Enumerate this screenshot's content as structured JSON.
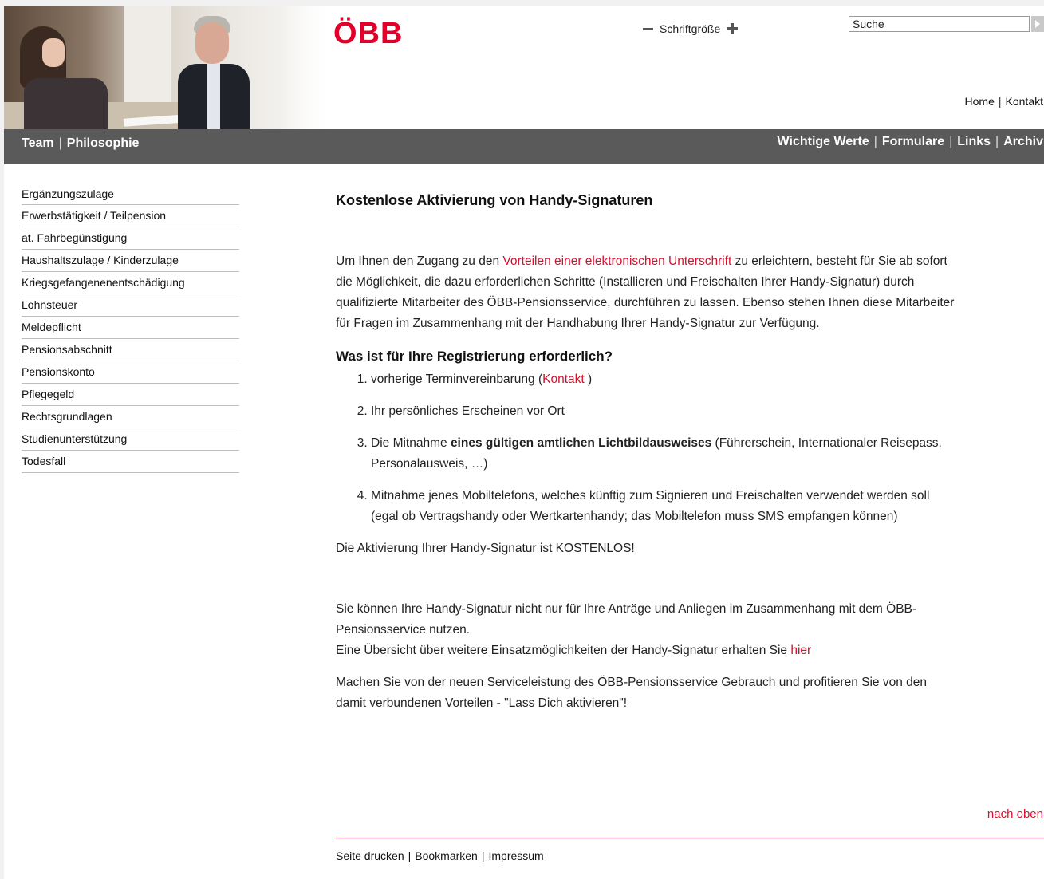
{
  "header": {
    "logo": "ÖBB",
    "font_size_label": "Schriftgröße",
    "search_placeholder": "Suche",
    "top_links": [
      "Home",
      "Kontakt"
    ]
  },
  "navbar": {
    "left": [
      "Team",
      "Philosophie"
    ],
    "right": [
      "Wichtige Werte",
      "Formulare",
      "Links",
      "Archiv"
    ]
  },
  "sidebar": {
    "items": [
      "Ergänzungszulage",
      "Erwerbstätigkeit / Teilpension",
      "at. Fahrbegünstigung",
      "Haushaltszulage / Kinderzulage",
      "Kriegsgefangenenentschädigung",
      "Lohnsteuer",
      "Meldepflicht",
      "Pensionsabschnitt",
      "Pensionskonto",
      "Pflegegeld",
      "Rechtsgrundlagen",
      "Studienunterstützung",
      "Todesfall"
    ]
  },
  "main": {
    "title": "Kostenlose Aktivierung von Handy-Signaturen",
    "intro_pre": "Um Ihnen den Zugang zu den ",
    "intro_link": "Vorteilen einer elektronischen Unterschrift",
    "intro_post": " zu erleichtern, besteht für Sie ab sofort die Möglichkeit, die dazu erforderlichen Schritte (Installieren und Freischalten Ihrer Handy-Signatur) durch qualifizierte Mitarbeiter des ÖBB-Pensionsservice, durchführen zu lassen. Ebenso stehen Ihnen diese Mitarbeiter für Fragen im Zusammenhang mit der Handhabung Ihrer Handy-Signatur zur Verfügung.",
    "subtitle": "Was ist für Ihre Registrierung erforderlich?",
    "step1_pre": "vorherige Terminvereinbarung (",
    "step1_link": "Kontakt",
    "step1_post": " )",
    "step2": "Ihr persönliches Erscheinen vor Ort",
    "step3_pre": "Die Mitnahme ",
    "step3_bold": "eines gültigen amtlichen Lichtbildausweises",
    "step3_post": " (Führerschein, Internationaler Reisepass, Personalausweis, …)",
    "step4": "Mitnahme jenes Mobiltelefons, welches  künftig zum Signieren und Freischalten verwendet werden soll (egal ob Vertragshandy oder Wertkartenhandy; das Mobiltelefon muss SMS empfangen können)",
    "free_note": "Die Aktivierung Ihrer Handy-Signatur ist KOSTENLOS!",
    "use_text": "Sie können Ihre Handy-Signatur nicht nur für Ihre Anträge und Anliegen im Zusammenhang mit dem ÖBB-Pensionsservice nutzen.",
    "overview_pre": "Eine Übersicht über weitere Einsatzmöglichkeiten der Handy-Signatur erhalten Sie ",
    "overview_link": "hier",
    "closing": "Machen Sie von der neuen Serviceleistung des ÖBB-Pensionsservice Gebrauch und profitieren Sie von den damit verbundenen Vorteilen - \"Lass Dich aktivieren\"!"
  },
  "footer": {
    "back_to_top": "nach oben",
    "links": [
      "Seite drucken",
      "Bookmarken",
      "Impressum"
    ]
  },
  "colors": {
    "brand_red": "#e2002a",
    "link_red": "#d3112d",
    "navbar_gray": "#5a5a5a"
  }
}
